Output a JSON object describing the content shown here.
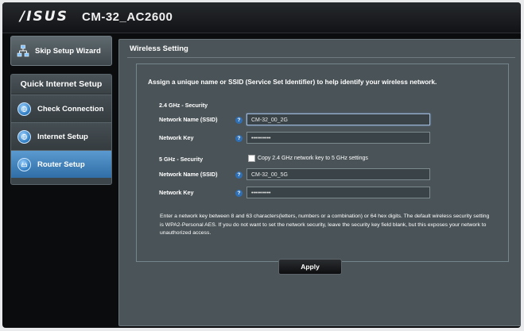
{
  "header": {
    "brand": "/ISUS",
    "model": "CM-32_AC2600"
  },
  "sidebar": {
    "skip_button": {
      "label": "Skip Setup Wizard",
      "icon": "network-icon"
    },
    "qis_title": "Quick Internet Setup",
    "items": [
      {
        "label": "Check Connection",
        "icon": "globe-icon",
        "active": false
      },
      {
        "label": "Internet Setup",
        "icon": "globe-icon",
        "active": false
      },
      {
        "label": "Router Setup",
        "icon": "router-icon",
        "active": true
      }
    ]
  },
  "main": {
    "title": "Wireless Setting",
    "instruction": "Assign a unique name or SSID (Service Set Identifier) to help identify your wireless network.",
    "band_24": {
      "title": "2.4 GHz - Security",
      "ssid_label": "Network Name (SSID)",
      "ssid_value": "CM-32_00_2G",
      "key_label": "Network Key",
      "key_value": "••••••••••"
    },
    "band_5": {
      "title": "5 GHz - Security",
      "copy_label": "Copy 2.4 GHz network key to 5 GHz settings",
      "ssid_label": "Network Name (SSID)",
      "ssid_value": "CM-32_00_5G",
      "key_label": "Network Key",
      "key_value": "••••••••••"
    },
    "help_glyph": "?",
    "note": "Enter a network key between 8 and 63 characters(letters, numbers or a combination) or 64 hex digits. The default wireless security setting is WPA2-Personal AES. If you do not want to set the network security, leave the security key field blank, but this exposes your network to unauthorized access.",
    "apply_label": "Apply"
  },
  "colors": {
    "accent_active": "#3f82bf",
    "panel": "#4b5458",
    "frame": "#0b0c0e"
  }
}
